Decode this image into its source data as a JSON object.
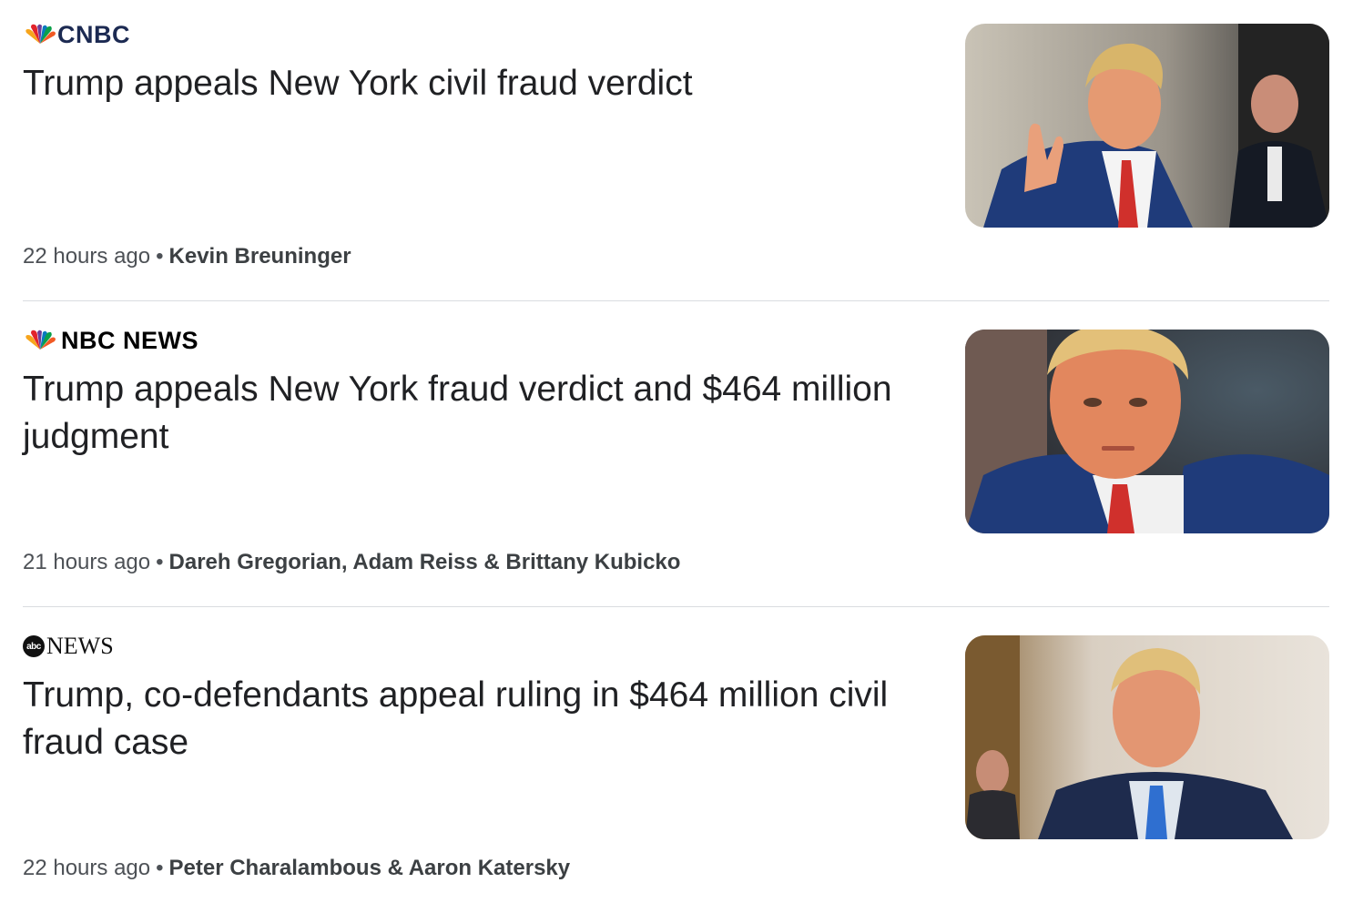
{
  "articles": [
    {
      "source": {
        "name": "CNBC",
        "logo_icon": "nbc-peacock-icon"
      },
      "headline": "Trump appeals New York civil fraud verdict",
      "time": "22 hours ago",
      "separator": "•",
      "authors": "Kevin Breuninger",
      "thumbnail": {
        "icon": "news-photo-thumbnail"
      }
    },
    {
      "source": {
        "name": "NBC NEWS",
        "logo_icon": "nbc-peacock-icon"
      },
      "headline": "Trump appeals New York fraud verdict and $464 million judgment",
      "time": "21 hours ago",
      "separator": "•",
      "authors": "Dareh Gregorian, Adam Reiss & Brittany Kubicko",
      "thumbnail": {
        "icon": "news-photo-thumbnail"
      }
    },
    {
      "source": {
        "name": "NEWS",
        "logo_text": "abc",
        "logo_icon": "abc-logo-icon"
      },
      "headline": "Trump, co-defendants appeal ruling in $464 million civil fraud case",
      "time": "22 hours ago",
      "separator": "•",
      "authors": "Peter Charalambous & Aaron Katersky",
      "thumbnail": {
        "icon": "news-photo-thumbnail"
      }
    }
  ],
  "colors": {
    "headline": "#202124",
    "meta": "#4d5156",
    "divider": "#dadce0",
    "cnbc_logo": "#1c2a52",
    "suit_navy": "#1f3b7a",
    "tie_red": "#d0302c",
    "tie_blue": "#2f6fd0"
  }
}
